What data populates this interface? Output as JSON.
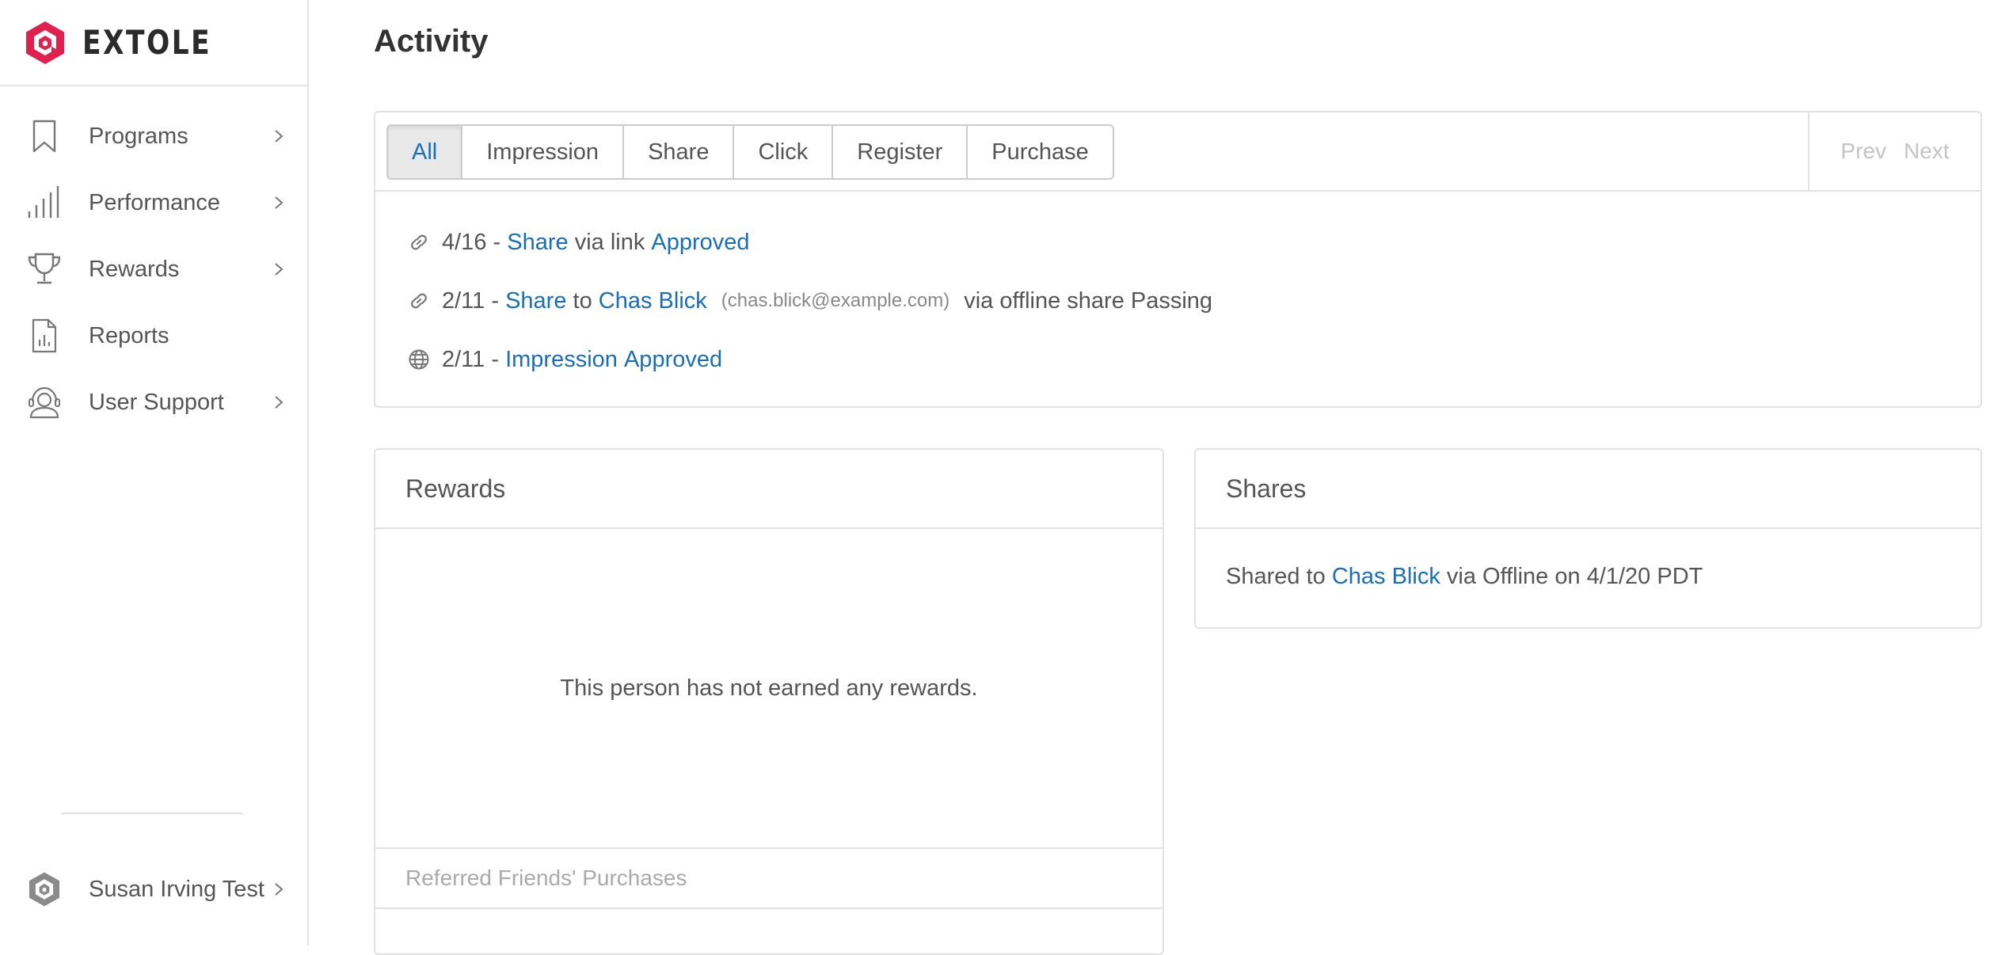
{
  "brand": {
    "name": "EXTOLE",
    "accent_color": "#e0204f"
  },
  "sidebar": {
    "items": [
      {
        "label": "Programs",
        "icon": "bookmark-icon",
        "has_submenu": true
      },
      {
        "label": "Performance",
        "icon": "signal-bars-icon",
        "has_submenu": true
      },
      {
        "label": "Rewards",
        "icon": "trophy-icon",
        "has_submenu": true
      },
      {
        "label": "Reports",
        "icon": "report-document-icon",
        "has_submenu": false
      },
      {
        "label": "User Support",
        "icon": "headset-icon",
        "has_submenu": true
      }
    ],
    "user": {
      "name": "Susan Irving Test",
      "icon": "extole-logo-gray-icon"
    }
  },
  "page": {
    "title": "Activity"
  },
  "activity": {
    "filters": [
      "All",
      "Impression",
      "Share",
      "Click",
      "Register",
      "Purchase"
    ],
    "active_filter": "All",
    "pager": {
      "prev": "Prev",
      "next": "Next"
    },
    "rows": [
      {
        "icon": "link-icon",
        "date": "4/16 -",
        "event": "Share",
        "text1": "via link",
        "status": "Approved"
      },
      {
        "icon": "link-icon",
        "date": "2/11 -",
        "event": "Share",
        "text1": "to",
        "person": "Chas Blick",
        "email": "(chas.blick@example.com)",
        "text2": "via offline share Passing"
      },
      {
        "icon": "globe-icon",
        "date": "2/11 -",
        "event": "Impression",
        "status": "Approved"
      }
    ]
  },
  "rewards": {
    "title": "Rewards",
    "empty_message": "This person has not earned any rewards.",
    "referred_title": "Referred Friends' Purchases"
  },
  "shares": {
    "title": "Shares",
    "prefix": "Shared to",
    "person": "Chas Blick",
    "suffix": "via Offline on 4/1/20 PDT"
  },
  "colors": {
    "link": "#1a6eb8",
    "text": "#555555",
    "muted": "#aaaaaa",
    "border": "#e2e2e2"
  }
}
